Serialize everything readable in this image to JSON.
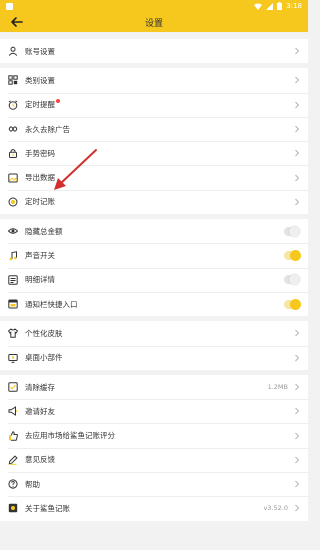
{
  "status_bar": {
    "time": "3:18"
  },
  "app_bar": {
    "title": "设置"
  },
  "groups": [
    {
      "items": [
        {
          "label": "账号设置",
          "icon": "person-icon"
        }
      ]
    },
    {
      "items": [
        {
          "label": "类别设置",
          "icon": "grid-icon"
        },
        {
          "label": "定时提醒",
          "icon": "alarm-icon",
          "badge": true
        },
        {
          "label": "永久去除广告",
          "icon": "infinity-icon"
        },
        {
          "label": "手势密码",
          "icon": "lock-icon"
        },
        {
          "label": "导出数据",
          "icon": "image-icon"
        },
        {
          "label": "定时记账",
          "icon": "timer-icon"
        }
      ]
    },
    {
      "items": [
        {
          "label": "隐藏总金额",
          "icon": "eye-icon",
          "toggle": false
        },
        {
          "label": "声音开关",
          "icon": "music-icon",
          "toggle": true
        },
        {
          "label": "明细详情",
          "icon": "list-icon",
          "toggle": false
        },
        {
          "label": "通知栏快捷入口",
          "icon": "notification-icon",
          "toggle": true
        }
      ]
    },
    {
      "items": [
        {
          "label": "个性化皮肤",
          "icon": "tshirt-icon"
        },
        {
          "label": "桌面小部件",
          "icon": "widget-icon"
        }
      ]
    },
    {
      "items": [
        {
          "label": "清除缓存",
          "icon": "broom-icon",
          "value": "1.2MB"
        },
        {
          "label": "邀请好友",
          "icon": "megaphone-icon"
        },
        {
          "label": "去应用市场给鲨鱼记账评分",
          "icon": "thumbs-up-icon"
        },
        {
          "label": "意见反馈",
          "icon": "pencil-icon"
        },
        {
          "label": "帮助",
          "icon": "help-icon"
        },
        {
          "label": "关于鲨鱼记账",
          "icon": "info-icon",
          "value": "v3.52.0"
        }
      ]
    }
  ],
  "colors": {
    "accent": "#f6c81e",
    "badge": "#ff4444",
    "annotation_arrow": "#d32f2f"
  }
}
